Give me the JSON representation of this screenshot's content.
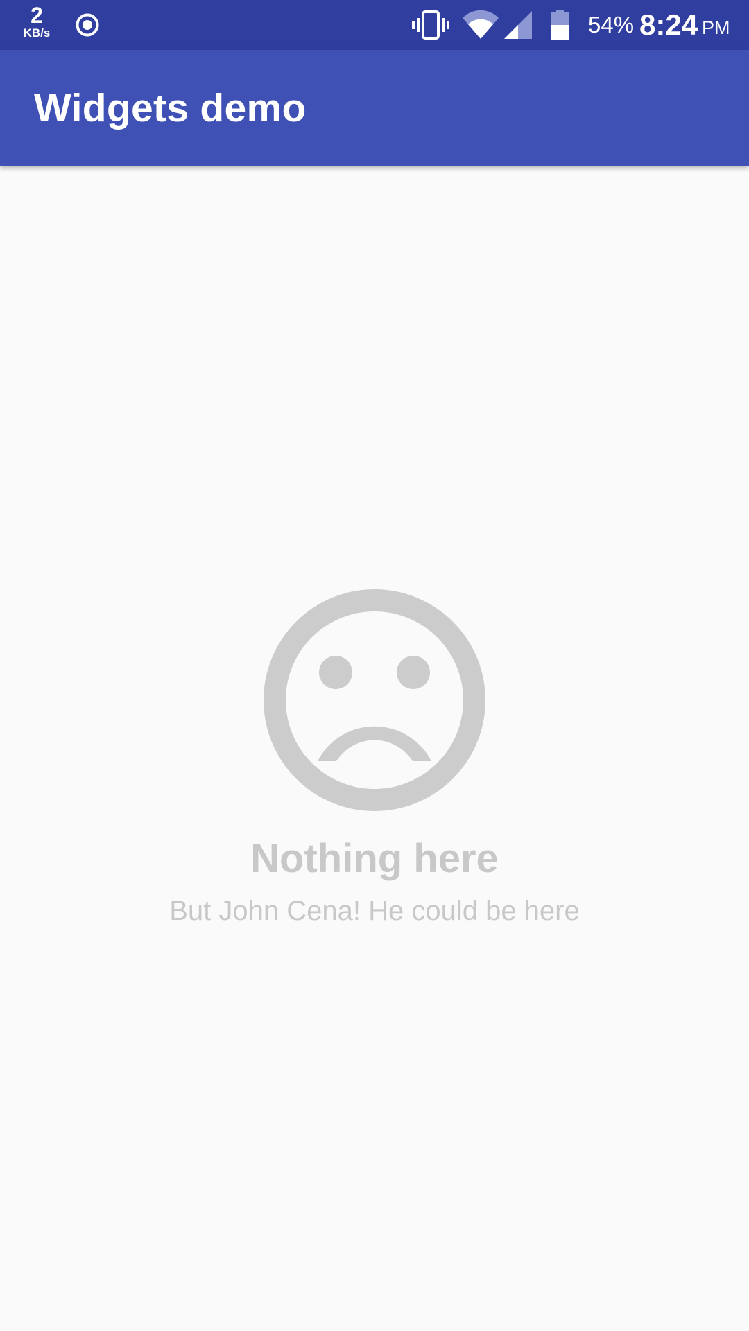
{
  "status_bar": {
    "net_speed_value": "2",
    "net_speed_unit": "KB/s",
    "icons": [
      "sync-circle-icon",
      "vibrate-icon",
      "wifi-icon",
      "cell-signal-icon",
      "battery-icon"
    ],
    "battery_percent": "54%",
    "time": "8:24",
    "ampm": "PM"
  },
  "app_bar": {
    "title": "Widgets demo"
  },
  "empty_state": {
    "icon": "sad-face-icon",
    "title": "Nothing here",
    "subtitle": "But John Cena! He could be here"
  },
  "colors": {
    "status_bar": "#303f9f",
    "app_bar": "#3f51b5",
    "background": "#fafafa",
    "empty_state_gray": "#c8c8c8"
  }
}
